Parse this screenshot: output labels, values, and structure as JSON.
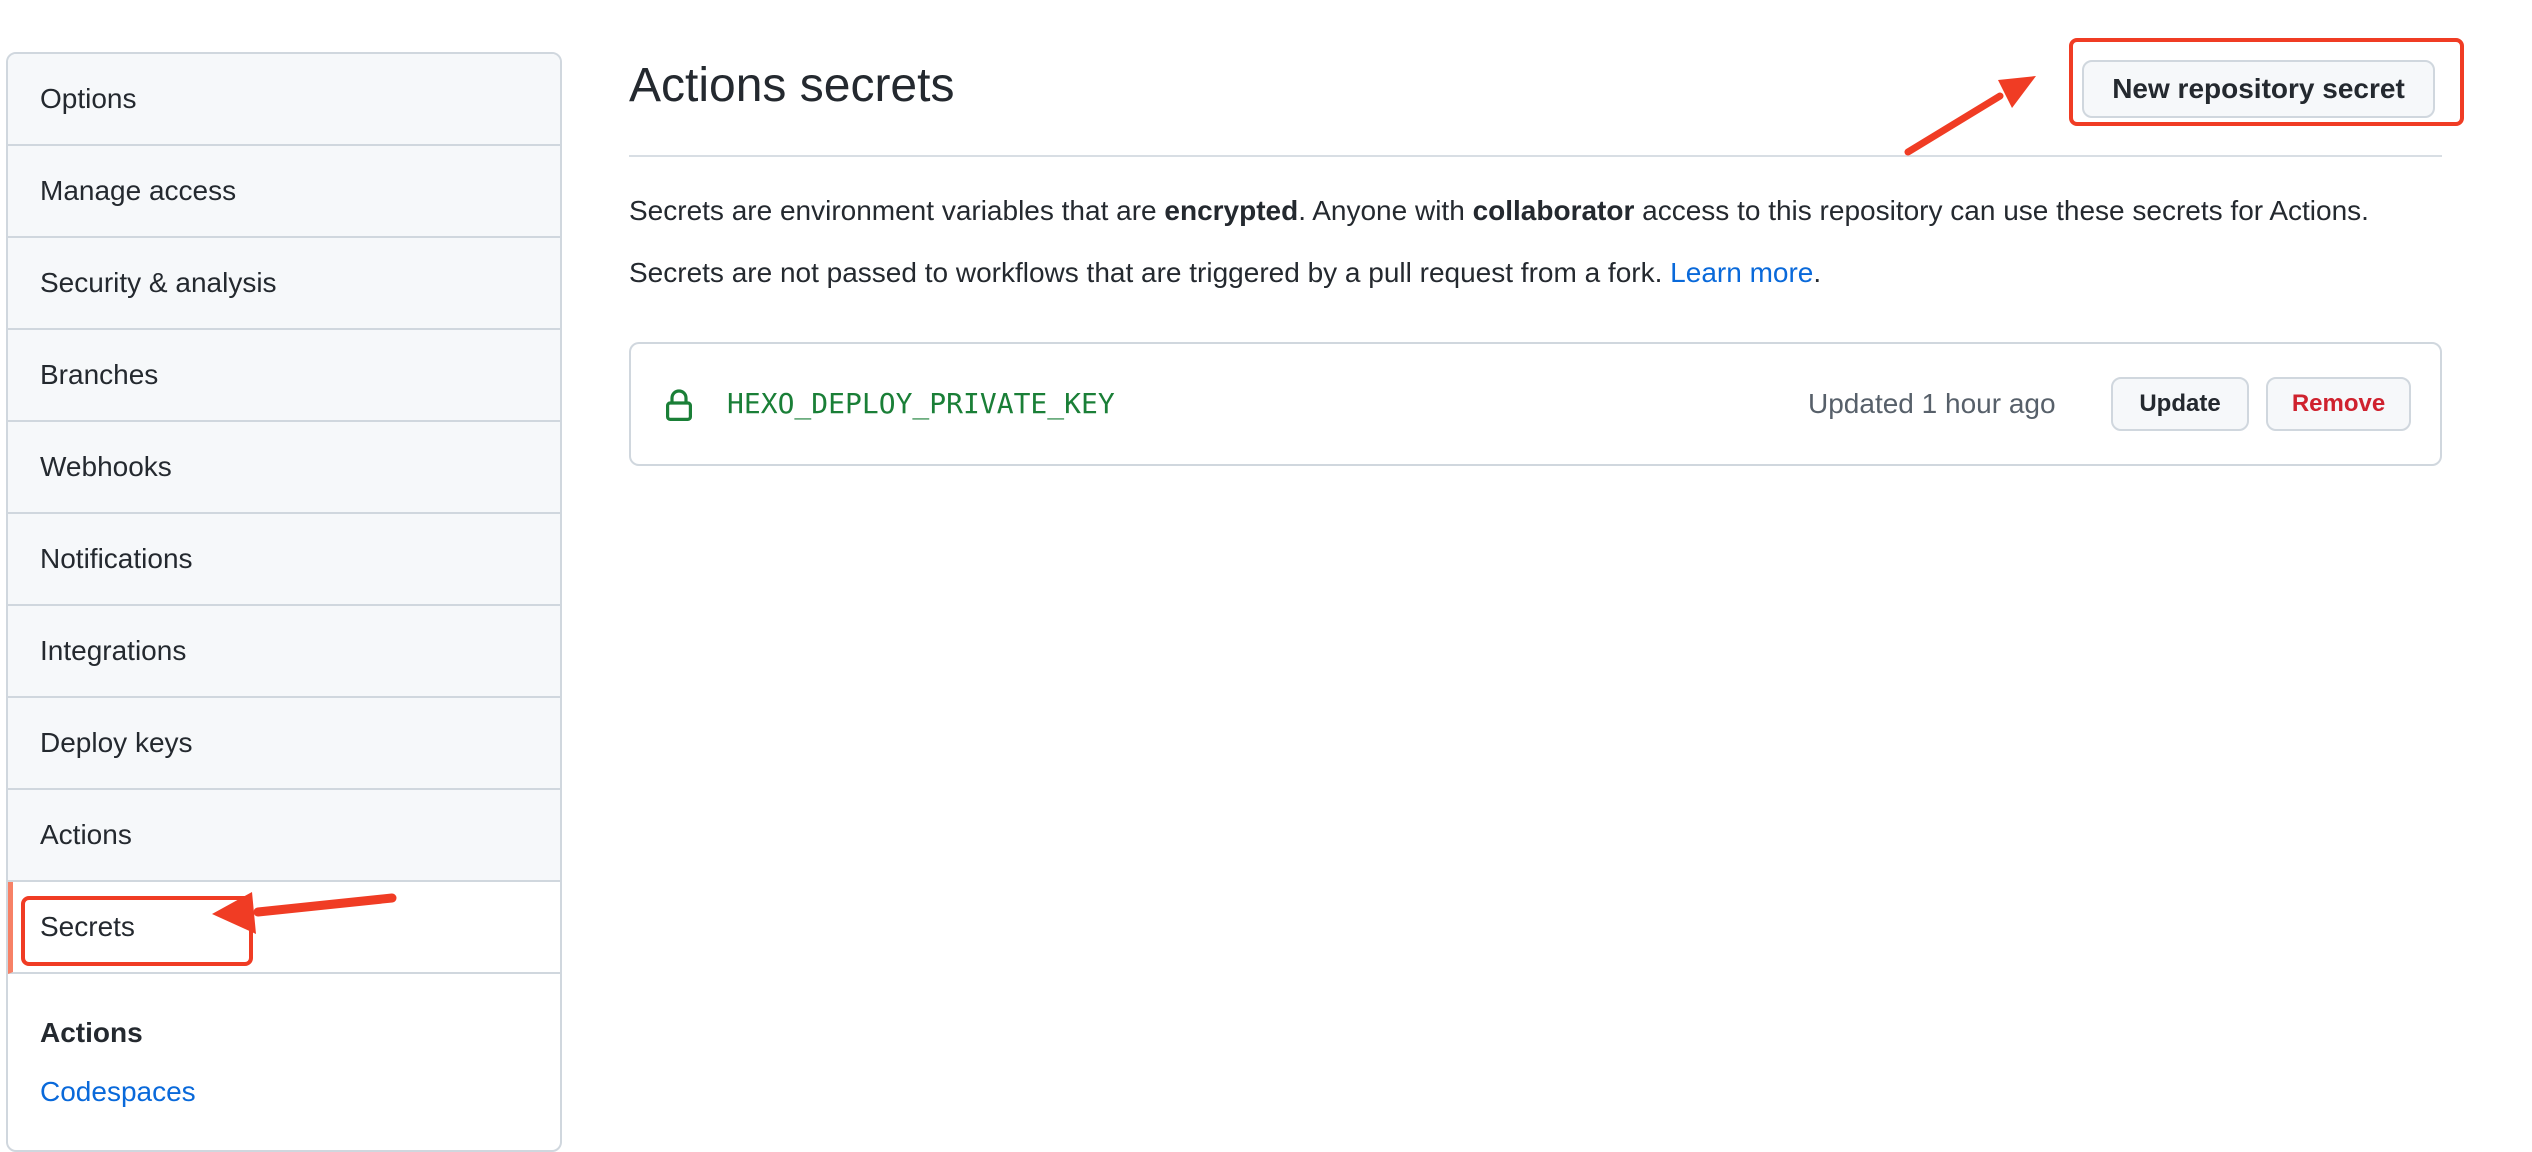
{
  "sidebar": {
    "items": [
      {
        "label": "Options"
      },
      {
        "label": "Manage access"
      },
      {
        "label": "Security & analysis"
      },
      {
        "label": "Branches"
      },
      {
        "label": "Webhooks"
      },
      {
        "label": "Notifications"
      },
      {
        "label": "Integrations"
      },
      {
        "label": "Deploy keys"
      },
      {
        "label": "Actions"
      },
      {
        "label": "Secrets",
        "selected": true
      }
    ],
    "section_heading": "Actions",
    "section_link": "Codespaces"
  },
  "main": {
    "title": "Actions secrets",
    "new_secret_button": "New repository secret",
    "description_1": {
      "part1": "Secrets are environment variables that are ",
      "bold1": "encrypted",
      "part2": ". Anyone with ",
      "bold2": "collaborator",
      "part3": " access to this repository can use these secrets for Actions."
    },
    "description_2": {
      "text": "Secrets are not passed to workflows that are triggered by a pull request from a fork. ",
      "link": "Learn more",
      "end": "."
    },
    "secrets": [
      {
        "name": "HEXO_DEPLOY_PRIVATE_KEY",
        "updated": "Updated 1 hour ago",
        "update_label": "Update",
        "remove_label": "Remove",
        "icon": "lock-icon"
      }
    ]
  },
  "colors": {
    "accent_link": "#0969da",
    "secret_name": "#1a7f37",
    "danger": "#cf222e",
    "selected_marker": "#f78166",
    "annotation": "#f03c24"
  }
}
